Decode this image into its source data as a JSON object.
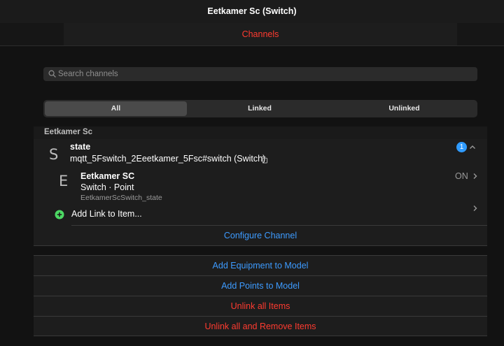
{
  "navbar": {
    "title": "Eetkamer Sc (Switch)"
  },
  "tabs": {
    "active_label": "Channels"
  },
  "search": {
    "placeholder": "Search channels",
    "value": "",
    "icon": "search-icon"
  },
  "filter": {
    "options": [
      "All",
      "Linked",
      "Unlinked"
    ],
    "selected": "All"
  },
  "group": {
    "title": "Eetkamer Sc"
  },
  "channel": {
    "letter": "S",
    "name": "state",
    "uid": "mqtt_5Fswitch_2Eeetkamer_5Fsc#switch (Switch)",
    "badge": "1",
    "link": {
      "letter": "E",
      "item_name": "Eetkamer SC",
      "item_type": "Switch · Point",
      "item_id": "EetkamerScSwitch_state",
      "state": "ON"
    },
    "add_link_label": "Add Link to Item...",
    "configure_label": "Configure Channel"
  },
  "actions": {
    "add_equipment": "Add Equipment to Model",
    "add_points": "Add Points to Model",
    "unlink_all": "Unlink all Items",
    "unlink_remove": "Unlink all and Remove Items"
  },
  "colors": {
    "accent_red": "#ff3b30",
    "accent_blue": "#3d9bff",
    "badge_blue": "#2f9bff",
    "add_green": "#4cd964"
  }
}
